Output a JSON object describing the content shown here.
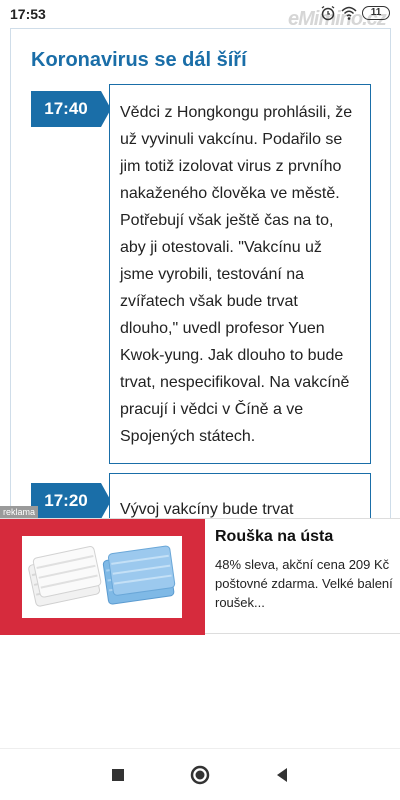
{
  "status_bar": {
    "time": "17:53",
    "watermark": "eMimino.cz",
    "battery": "11",
    "icons": [
      "alarm-icon",
      "wifi-icon",
      "battery-icon"
    ]
  },
  "article": {
    "section_title": "Koronavirus se dál šíří",
    "entries": [
      {
        "time": "17:40",
        "text": "Vědci z Hongkongu prohlásili, že už vyvinuli vakcínu. Podařilo se jim totiž izolovat virus z prvního nakaženého člověka ve městě. Potřebují však ještě čas na to, aby ji otestovali. \"Vakcínu už jsme vyrobili, testování na zvířatech však bude trvat dlouho,\" uvedl profesor Yuen Kwok-yung. Jak dlouho to bude trvat, nespecifikoval. Na vakcíně pracují i vědci v Číně a ve Spojených státech."
      },
      {
        "time": "17:20",
        "text": "Vývoj vakcíny bude trvat"
      }
    ]
  },
  "ad": {
    "label": "reklama",
    "title": "Rouška na ústa",
    "description_line1": "48% sleva, akční cena 209 Kč",
    "description_line2": "poštovné zdarma. Velké balení",
    "description_line3": "roušek...",
    "accent_color": "#d62b3d"
  },
  "nav": {
    "buttons": [
      "recent-apps",
      "home",
      "back"
    ]
  },
  "colors": {
    "brand": "#1a6ea8"
  }
}
